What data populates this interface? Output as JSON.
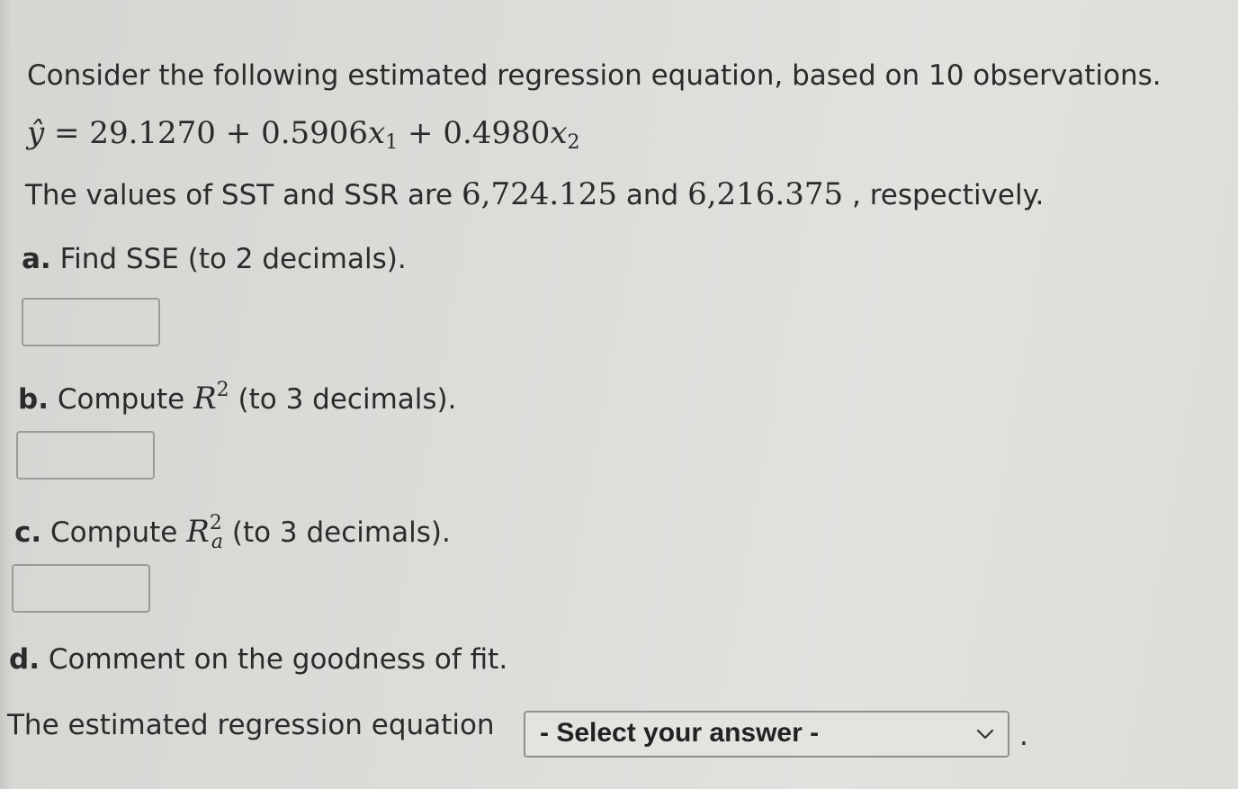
{
  "intro": {
    "text": "Consider the following estimated regression equation, based on 10 observations."
  },
  "equation": {
    "lhs": "ŷ",
    "equals": "=",
    "b0": "29.1270",
    "plus1": "+",
    "b1": "0.5906",
    "x1": "x",
    "x1_sub": "1",
    "plus2": "+",
    "b2": "0.4980",
    "x2": "x",
    "x2_sub": "2"
  },
  "given": {
    "prefix": "The values of SST and SSR are",
    "sst": "6,724.125",
    "middle": "and",
    "ssr": "6,216.375",
    "suffix": ", respectively."
  },
  "part_a": {
    "letter": "a.",
    "text": "Find SSE (to 2 decimals).",
    "answer_value": ""
  },
  "part_b": {
    "letter": "b.",
    "text_before": "Compute",
    "symbol": "R",
    "superscript": "2",
    "text_after": "(to 3 decimals).",
    "answer_value": ""
  },
  "part_c": {
    "letter": "c.",
    "text_before": "Compute",
    "symbol": "R",
    "superscript": "2",
    "subscript": "a",
    "text_after": "(to 3 decimals).",
    "answer_value": ""
  },
  "part_d": {
    "letter": "d.",
    "text": "Comment on the goodness of fit."
  },
  "conclusion": {
    "prefix": "The estimated regression equation",
    "select_label": "- Select your answer -",
    "suffix": "."
  },
  "icons": {
    "select_arrow": "chevron-down-icon"
  }
}
